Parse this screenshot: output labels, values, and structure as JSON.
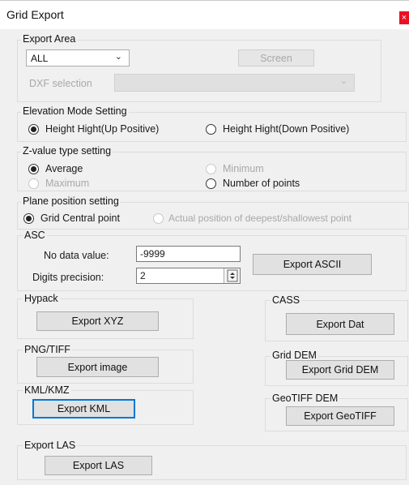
{
  "window": {
    "title": "Grid Export",
    "close_glyph": "×"
  },
  "export_area": {
    "legend": "Export Area",
    "area_select": "ALL",
    "screen_button": "Screen",
    "dxf_label": "DXF selection",
    "dxf_value": ""
  },
  "elevation": {
    "legend": "Elevation Mode Setting",
    "up_label": "Height Hight(Up Positive)",
    "down_label": "Height Hight(Down Positive)",
    "selected": "up"
  },
  "zvalue": {
    "legend": "Z-value type setting",
    "average": "Average",
    "minimum": "Minimum",
    "maximum": "Maximum",
    "count": "Number of points",
    "selected": "average"
  },
  "plane": {
    "legend": "Plane position setting",
    "central": "Grid Central point",
    "actual": "Actual position of deepest/shallowest point",
    "selected": "central"
  },
  "asc": {
    "legend": "ASC",
    "nodata_label": "No data value:",
    "nodata_value": "-9999",
    "digits_label": "Digits precision:",
    "digits_value": "2",
    "export_button": "Export ASCII"
  },
  "hypack": {
    "legend": "Hypack",
    "button": "Export XYZ"
  },
  "cass": {
    "legend": "CASS",
    "button": "Export Dat"
  },
  "png": {
    "legend": "PNG/TIFF",
    "button": "Export image"
  },
  "griddem": {
    "legend": "Grid DEM",
    "button": "Export Grid DEM"
  },
  "kml": {
    "legend": "KML/KMZ",
    "button": "Export KML"
  },
  "geotiff": {
    "legend": "GeoTIFF DEM",
    "button": "Export GeoTIFF"
  },
  "las": {
    "legend": "Export LAS",
    "button": "Export LAS"
  },
  "icons": {
    "chevron": "chevron-down-icon",
    "spin": "spin-updown-icon",
    "close": "close-icon"
  },
  "colors": {
    "close_bg": "#e81123",
    "focus_border": "#0078d7",
    "dialog_bg": "#f0f0f0"
  }
}
